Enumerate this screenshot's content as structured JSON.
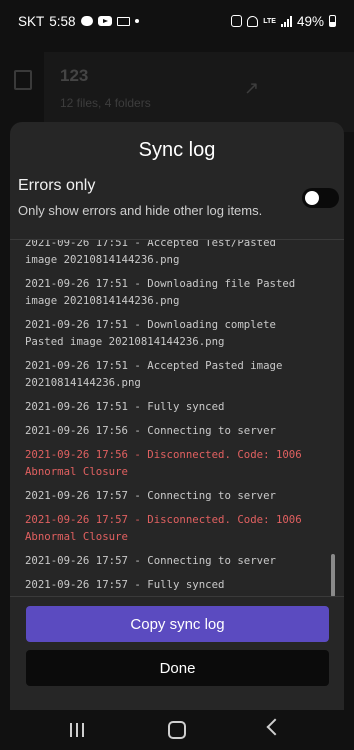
{
  "status_bar": {
    "carrier": "SKT",
    "time": "5:58",
    "battery": "49%",
    "network": "LTE",
    "icons": [
      "chat-bubble-icon",
      "youtube-icon",
      "mail-icon",
      "dot-icon",
      "alarm-icon",
      "mute-icon",
      "lte-icon",
      "signal-icon",
      "battery-icon"
    ]
  },
  "background_app": {
    "title": "123",
    "subtitle": "12 files, 4 folders",
    "icons": [
      "file-icon",
      "pin-icon"
    ]
  },
  "sheet": {
    "title": "Sync log",
    "errors_only": {
      "label": "Errors only",
      "description": "Only show errors and hide other log items.",
      "enabled": false
    },
    "log": [
      {
        "text": "2021-09-26 17:51 - Accepted Test/Pasted\nimage 20210814144236.png",
        "error": false
      },
      {
        "text": "2021-09-26 17:51 - Downloading file Pasted\nimage 20210814144236.png",
        "error": false
      },
      {
        "text": "2021-09-26 17:51 - Downloading complete\nPasted image 20210814144236.png",
        "error": false
      },
      {
        "text": "2021-09-26 17:51 - Accepted Pasted image\n20210814144236.png",
        "error": false
      },
      {
        "text": "2021-09-26 17:51 - Fully synced",
        "error": false
      },
      {
        "text": "2021-09-26 17:56 - Connecting to server",
        "error": false
      },
      {
        "text": "2021-09-26 17:56 - Disconnected. Code: 1006\nAbnormal Closure",
        "error": true
      },
      {
        "text": "2021-09-26 17:57 - Connecting to server",
        "error": false
      },
      {
        "text": "2021-09-26 17:57 - Disconnected. Code: 1006\nAbnormal Closure",
        "error": true
      },
      {
        "text": "2021-09-26 17:57 - Connecting to server",
        "error": false
      },
      {
        "text": "2021-09-26 17:57 - Fully synced",
        "error": false
      }
    ],
    "copy_label": "Copy sync log",
    "done_label": "Done",
    "colors": {
      "accent": "#5b4bc0",
      "error": "#e06060",
      "sheet_bg": "#262626"
    }
  },
  "nav_bar": {
    "icons": [
      "recents-icon",
      "home-icon",
      "back-icon"
    ]
  }
}
